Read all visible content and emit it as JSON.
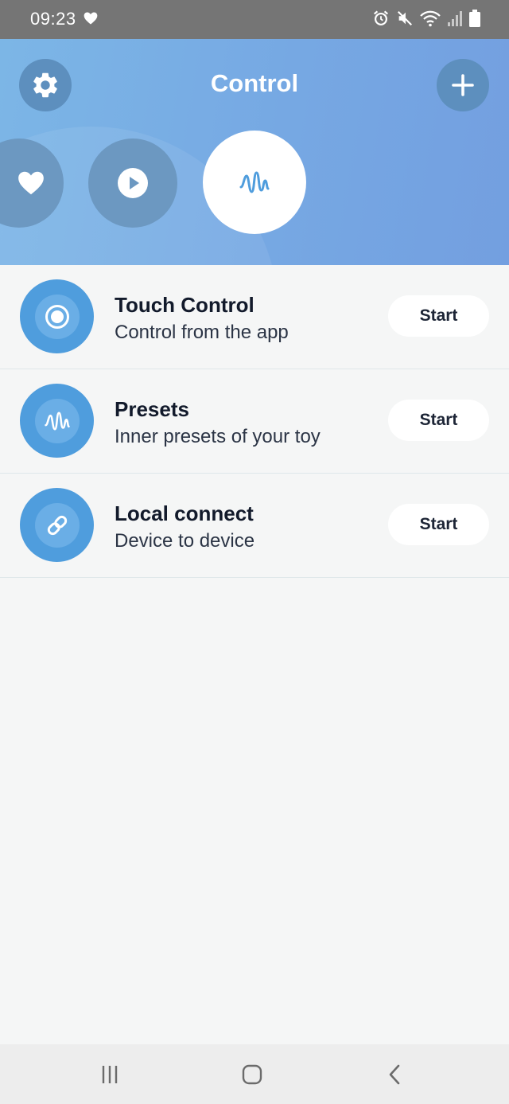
{
  "status_bar": {
    "time": "09:23",
    "icons": [
      "heart-icon",
      "alarm-icon",
      "mute-icon",
      "wifi-icon",
      "signal-icon",
      "battery-icon"
    ]
  },
  "header": {
    "title": "Control",
    "left_button_icon": "gear-icon",
    "right_button_icon": "plus-icon",
    "modes": [
      {
        "icon": "heart-icon",
        "selected": false
      },
      {
        "icon": "play-icon",
        "selected": false
      },
      {
        "icon": "wave-icon",
        "selected": true
      }
    ]
  },
  "items": [
    {
      "title": "Touch Control",
      "subtitle": "Control from the app",
      "icon": "target-icon",
      "button": "Start"
    },
    {
      "title": "Presets",
      "subtitle": "Inner presets of your toy",
      "icon": "wave-icon",
      "button": "Start"
    },
    {
      "title": "Local connect",
      "subtitle": "Device to device",
      "icon": "link-icon",
      "button": "Start"
    }
  ],
  "nav_bar": {
    "icons": [
      "recents-icon",
      "home-icon",
      "back-icon"
    ]
  },
  "colors": {
    "header_gradient_start": "#7cb6e6",
    "header_gradient_end": "#739fe0",
    "accent_blue": "#4f9ddd",
    "background": "#f5f6f6"
  }
}
